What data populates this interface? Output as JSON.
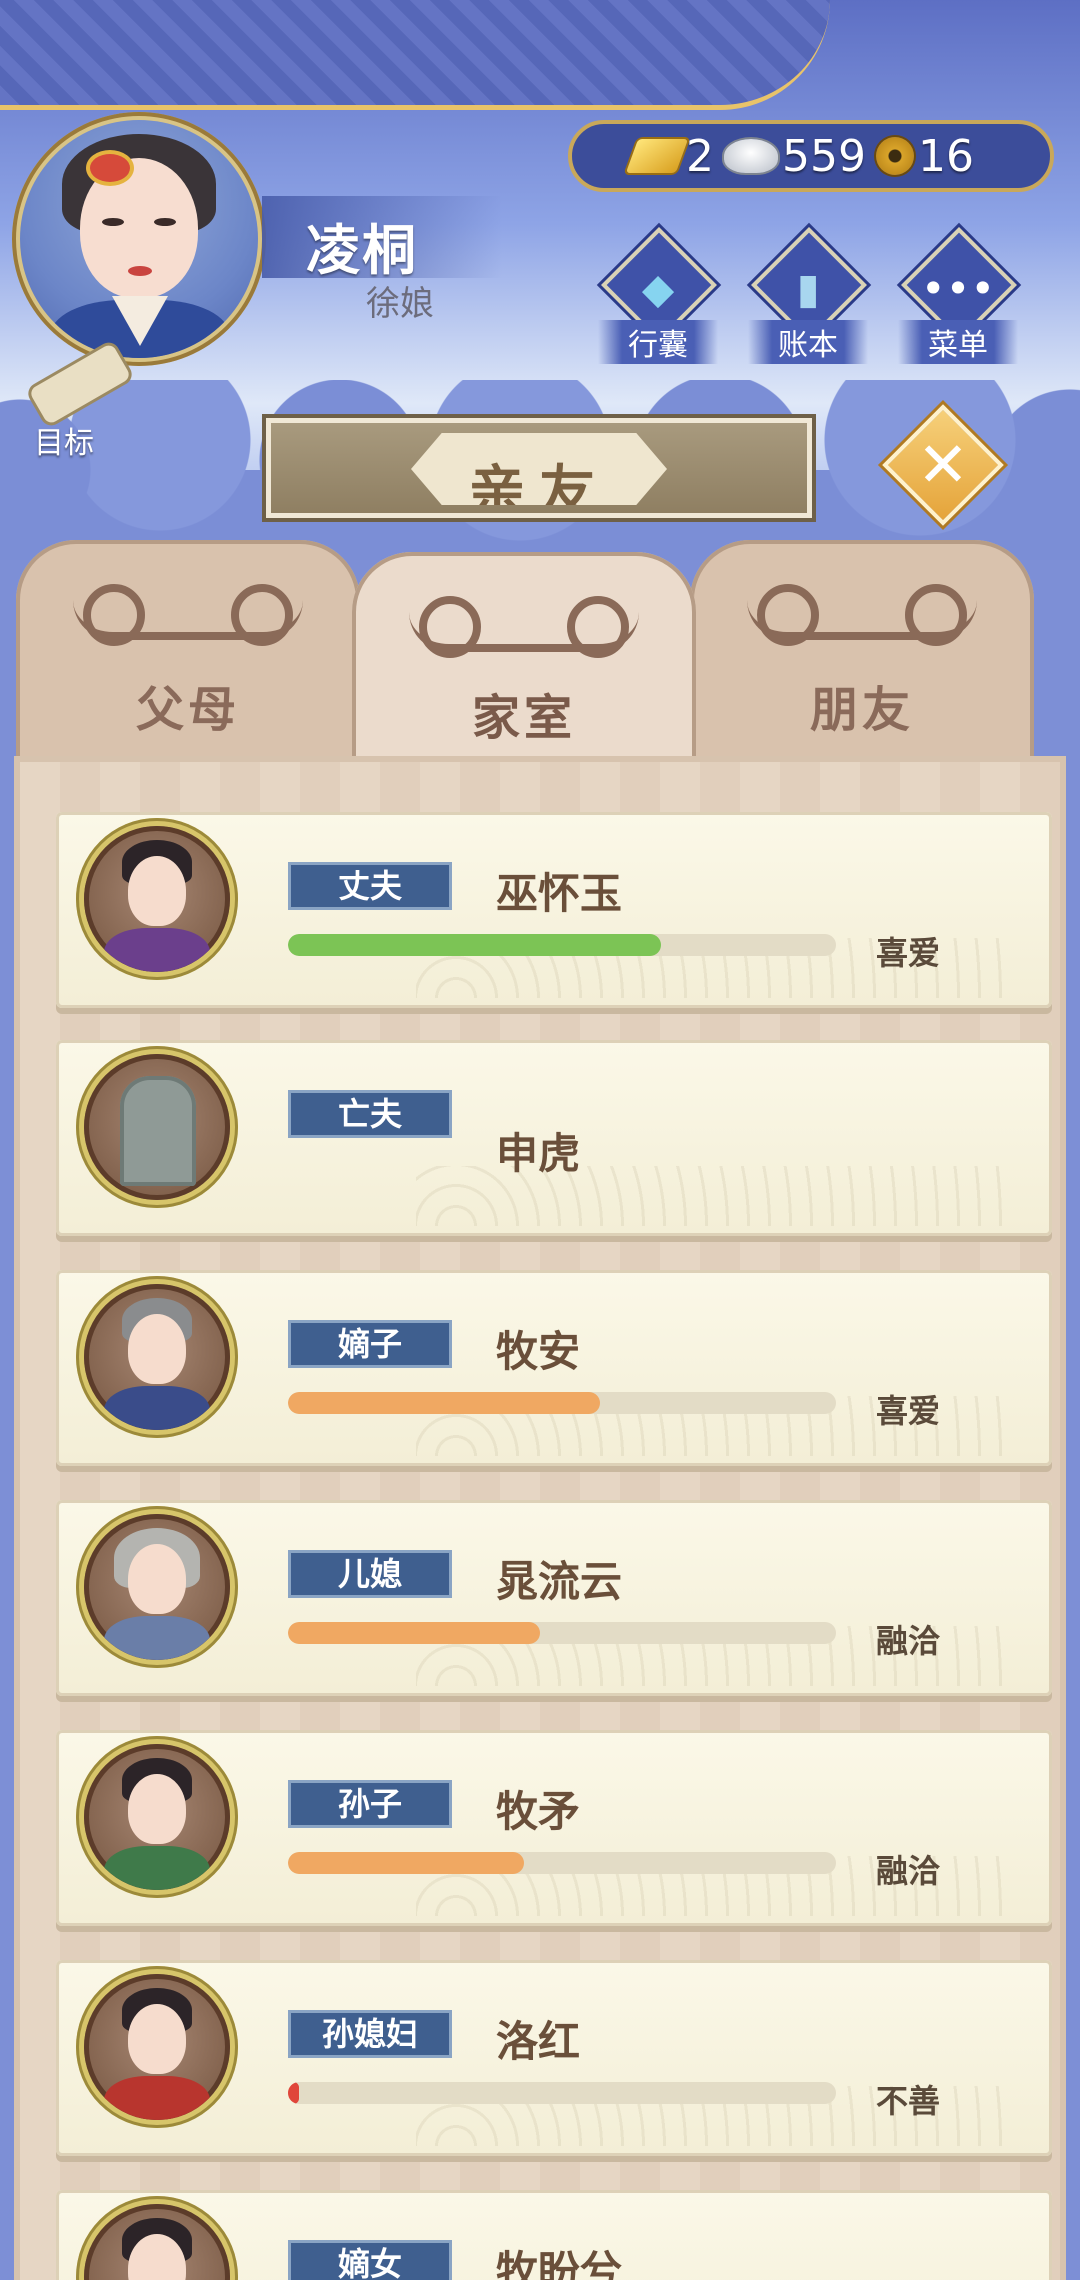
{
  "player": {
    "name": "凌桐",
    "title": "徐娘"
  },
  "currency": {
    "gold": "2",
    "silver": "559",
    "coins": "16"
  },
  "top_buttons": [
    {
      "label": "行囊",
      "icon": "bag-icon"
    },
    {
      "label": "账本",
      "icon": "ledger-icon"
    },
    {
      "label": "菜单",
      "icon": "menu-dots-icon"
    }
  ],
  "goal_label": "目标",
  "dialog": {
    "title": "亲友",
    "close_icon": "close-icon"
  },
  "tabs": [
    {
      "label": "父母",
      "active": false
    },
    {
      "label": "家室",
      "active": true
    },
    {
      "label": "朋友",
      "active": false
    }
  ],
  "colors": {
    "bar_green": "#7cc455",
    "bar_orange": "#f0a862",
    "bar_red": "#e0463a",
    "tag_blue": "#3f5f8f"
  },
  "relatives": [
    {
      "role": "丈夫",
      "name": "巫怀玉",
      "favor": 0.68,
      "favor_color": "#7cc455",
      "relation": "喜爱",
      "show_bar": true
    },
    {
      "role": "亡夫",
      "name": "申虎",
      "favor": null,
      "favor_color": "",
      "relation": "",
      "show_bar": false
    },
    {
      "role": "嫡子",
      "name": "牧安",
      "favor": 0.57,
      "favor_color": "#f0a862",
      "relation": "喜爱",
      "show_bar": true
    },
    {
      "role": "儿媳",
      "name": "晁流云",
      "favor": 0.46,
      "favor_color": "#f0a862",
      "relation": "融洽",
      "show_bar": true
    },
    {
      "role": "孙子",
      "name": "牧矛",
      "favor": 0.43,
      "favor_color": "#f0a862",
      "relation": "融洽",
      "show_bar": true
    },
    {
      "role": "孙媳妇",
      "name": "洛红",
      "favor": 0.02,
      "favor_color": "#e0463a",
      "relation": "不善",
      "show_bar": true
    },
    {
      "role": "嫡女",
      "name": "牧盼兮",
      "favor": null,
      "favor_color": "",
      "relation": "",
      "show_bar": false
    }
  ]
}
